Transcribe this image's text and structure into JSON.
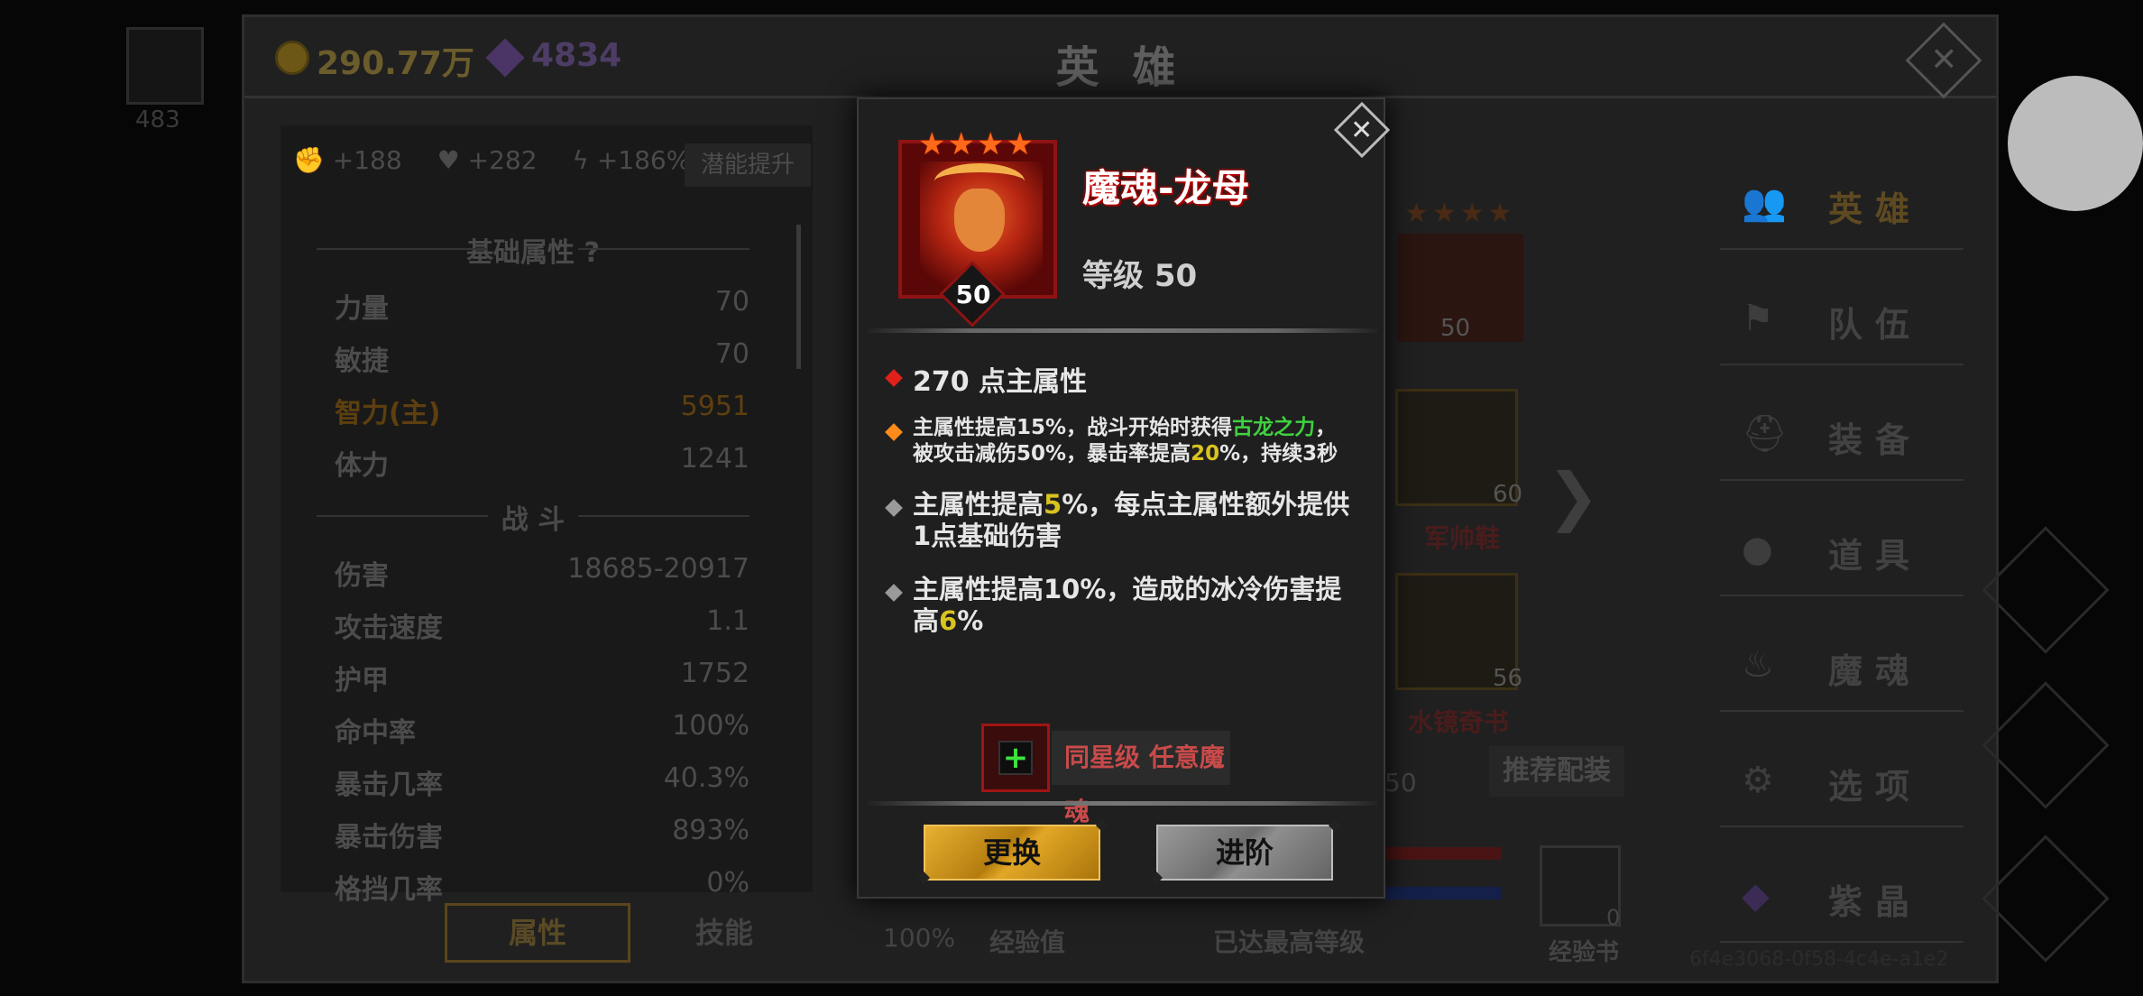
{
  "topbar": {
    "gold": "290.77万",
    "gems": "4834",
    "title": "英 雄",
    "close_symbol": "✕"
  },
  "side_avatar_count": "483",
  "attributes_panel": {
    "buffs": [
      {
        "icon": "strength-icon",
        "value": "+188"
      },
      {
        "icon": "heart-icon",
        "value": "+282"
      },
      {
        "icon": "lightning-icon",
        "value": "+186%"
      }
    ],
    "potential_button": "潜能提升",
    "base_section_title": "基础属性",
    "base_help": "?",
    "base_rows": [
      {
        "label": "力量",
        "value": "70"
      },
      {
        "label": "敏捷",
        "value": "70"
      },
      {
        "label": "智力(主)",
        "value": "5951"
      },
      {
        "label": "体力",
        "value": "1241"
      }
    ],
    "combat_section_title": "战 斗",
    "combat_rows": [
      {
        "label": "伤害",
        "value": "18685-20917"
      },
      {
        "label": "攻击速度",
        "value": "1.1"
      },
      {
        "label": "护甲",
        "value": "1752"
      },
      {
        "label": "命中率",
        "value": "100%"
      },
      {
        "label": "暴击几率",
        "value": "40.3%"
      },
      {
        "label": "暴击伤害",
        "value": "893%"
      },
      {
        "label": "格挡几率",
        "value": "0%"
      }
    ],
    "tab_attributes": "属性",
    "tab_skills": "技能"
  },
  "middle": {
    "hero_level": "50",
    "boots_level": "60",
    "boots_label": "军帅鞋",
    "book_level": "56",
    "book_label": "水镜奇书",
    "recommend_button": "推荐配装",
    "level_fragment": "50",
    "progress_percent": "100%",
    "exp_label": "经验值",
    "exp_status": "已达最高等级",
    "exp_book_label": "经验书",
    "exp_book_count": "0"
  },
  "side_menu": [
    {
      "icon": "people-icon",
      "label": "英雄",
      "active": true
    },
    {
      "icon": "flag-icon",
      "label": "队伍",
      "active": false
    },
    {
      "icon": "helmet-icon",
      "label": "装备",
      "active": false
    },
    {
      "icon": "bag-icon",
      "label": "道具",
      "active": false
    },
    {
      "icon": "fire-icon",
      "label": "魔魂",
      "active": false
    },
    {
      "icon": "gear-icon",
      "label": "选项",
      "active": false
    },
    {
      "icon": "crystal-icon",
      "label": "紫晶",
      "active": false
    }
  ],
  "uuid": "6f4e3068-0f58-4c4e-a1e2",
  "modal": {
    "stars": "★★★★",
    "portrait_level": "50",
    "name": "魔魂-龙母",
    "level_text": "等级 50",
    "close_symbol": "✕",
    "effects": [
      {
        "bullet_color": "#e0201a",
        "parts": [
          {
            "t": "270 点主属性"
          }
        ]
      },
      {
        "bullet_color": "#ff8c1a",
        "parts": [
          {
            "t": "主属性提高15%，战斗开始时获得"
          },
          {
            "t": "古龙之力",
            "c": "green"
          },
          {
            "t": "，"
          }
        ],
        "line2": [
          {
            "t": "被攻击减伤50%，暴击率提高"
          },
          {
            "t": "20",
            "c": "yellow"
          },
          {
            "t": "%，持续3秒"
          }
        ]
      },
      {
        "bullet_color": "#9a9a9a",
        "parts": [
          {
            "t": "主属性提高"
          },
          {
            "t": "5",
            "c": "yellow"
          },
          {
            "t": "%，每点主属性额外提供"
          }
        ],
        "line2": [
          {
            "t": "1点基础伤害"
          }
        ]
      },
      {
        "bullet_color": "#9a9a9a",
        "parts": [
          {
            "t": "主属性提高10%，造成的冰冷伤害提"
          }
        ],
        "line2": [
          {
            "t": "高"
          },
          {
            "t": "6",
            "c": "yellow"
          },
          {
            "t": "%"
          }
        ]
      }
    ],
    "add_symbol": "+",
    "add_label": "同星级 任意魔魂",
    "swap_button": "更换",
    "advance_button": "进阶"
  }
}
